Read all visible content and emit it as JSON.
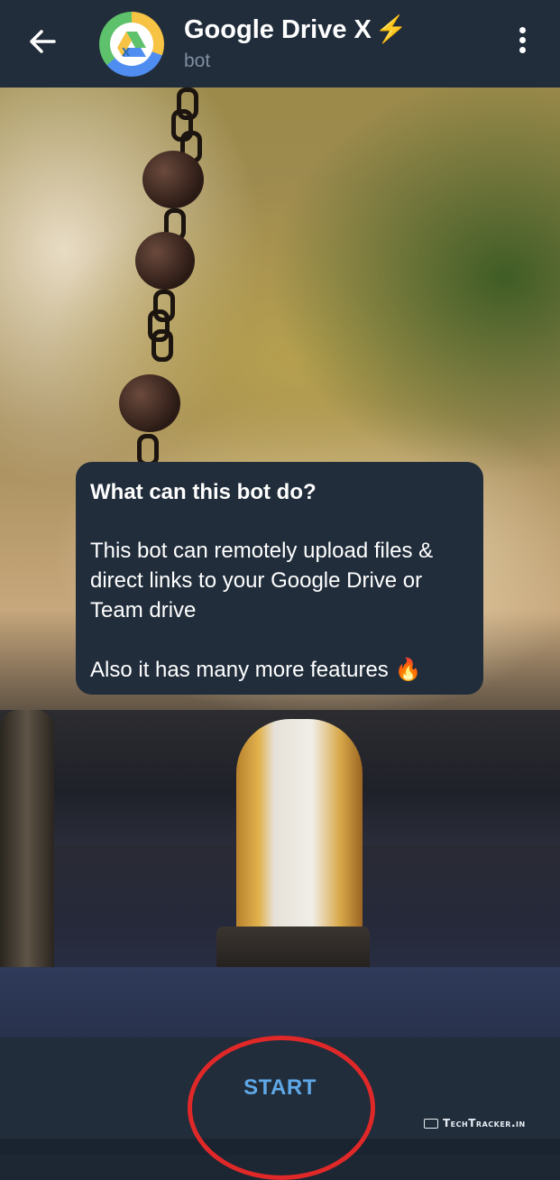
{
  "header": {
    "title": "Google Drive X",
    "title_emoji": "⚡",
    "subtitle": "bot",
    "back_icon": "arrow-left-icon",
    "menu_icon": "more-vertical-icon",
    "avatar": "google-drive-x-logo"
  },
  "bubble": {
    "title": "What can this bot do?",
    "description": "This bot can remotely upload files & direct links to your Google Drive or Team drive",
    "extra": "Also it has many more features 🔥"
  },
  "bottom": {
    "start_label": "START"
  },
  "watermark": {
    "text": "TechTracker.in"
  },
  "colors": {
    "header_bg": "#212d3b",
    "bubble_bg": "#212d3b",
    "start_text": "#5fa8e8",
    "annotation_circle": "#e02828",
    "subtitle": "#7f8e9e"
  }
}
